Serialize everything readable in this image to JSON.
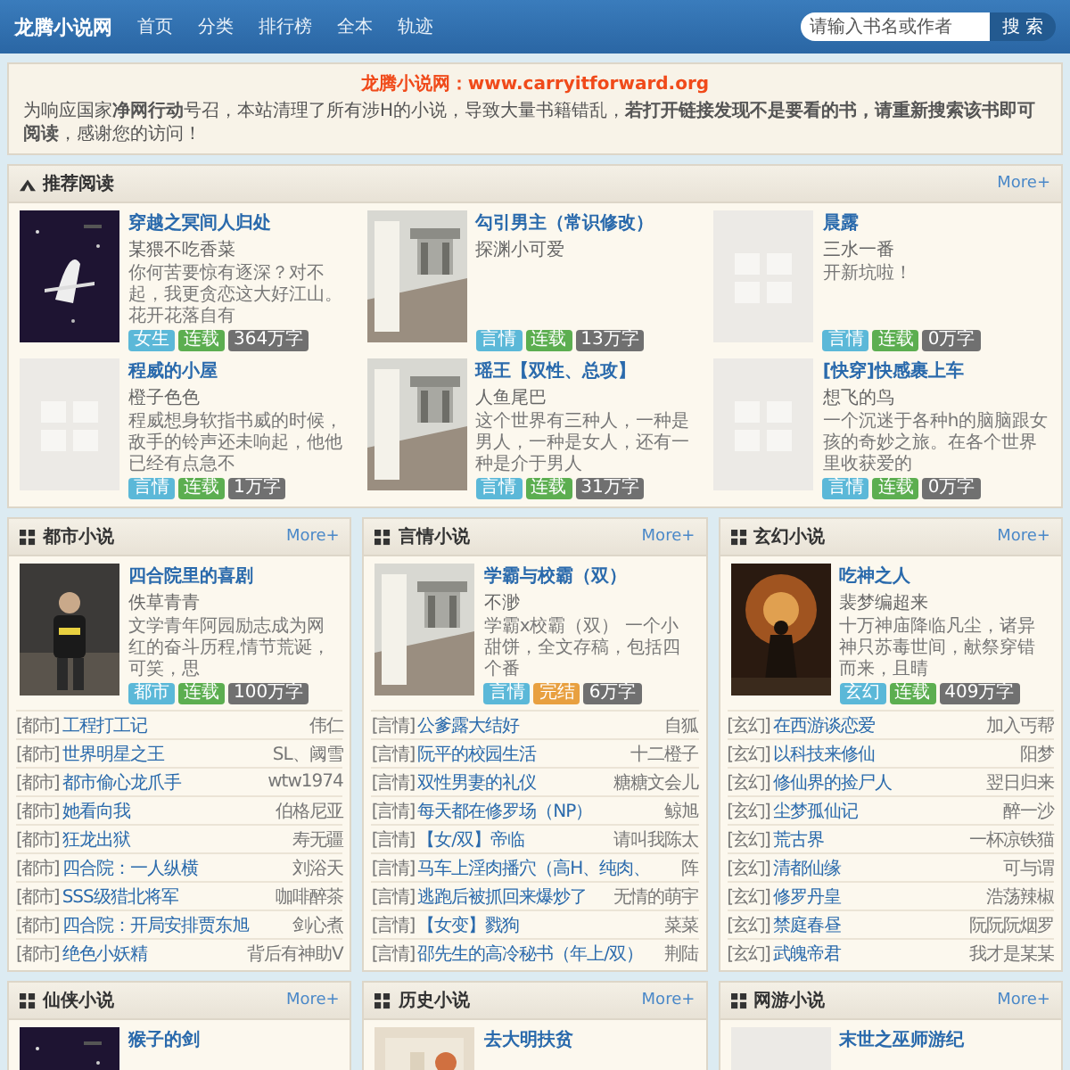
{
  "header": {
    "logo": "龙腾小说网",
    "nav": [
      {
        "label": "首页"
      },
      {
        "label": "分类"
      },
      {
        "label": "排行榜"
      },
      {
        "label": "全本"
      },
      {
        "label": "轨迹"
      }
    ],
    "search": {
      "placeholder": "请输入书名或作者",
      "button": "搜 索"
    }
  },
  "notice": {
    "title": "龙腾小说网：www.carryitforward.org",
    "text": "为响应国家**净网行动**号召，本站清理了所有涉H的小说，导致大量书籍错乱，**若打开链接发现不是要看的书，请重新搜索该书即可阅读**，感谢您的访问！"
  },
  "recommended": {
    "title": "推荐阅读",
    "more": "More+",
    "books": [
      {
        "title": "穿越之冥间人归处",
        "author": "某猥不吃香菜",
        "desc": "你何苦要惊有逐深？对不起，我更贪恋这大好江山。花开花落自有",
        "tags": [
          {
            "kind": "category",
            "text": "女生"
          },
          {
            "kind": "serial",
            "text": "连载"
          },
          {
            "kind": "count",
            "text": "364万字"
          }
        ]
      },
      {
        "title": "勾引男主（常识修改）",
        "author": "探渊小可爱",
        "tags": [
          {
            "kind": "category",
            "text": "言情"
          },
          {
            "kind": "serial",
            "text": "连载"
          },
          {
            "kind": "count",
            "text": "13万字"
          }
        ]
      },
      {
        "title": "晨露",
        "author": "三水一番",
        "desc": "开新坑啦！",
        "tags": [
          {
            "kind": "category",
            "text": "言情"
          },
          {
            "kind": "serial",
            "text": "连载"
          },
          {
            "kind": "count",
            "text": "0万字"
          }
        ]
      },
      {
        "title": "程威的小屋",
        "author": "橙子色色",
        "desc": "程威想身软指书威的时候，敌手的铃声还未响起，他他已经有点急不",
        "tags": [
          {
            "kind": "category",
            "text": "言情"
          },
          {
            "kind": "serial",
            "text": "连载"
          },
          {
            "kind": "count",
            "text": "1万字"
          }
        ]
      },
      {
        "title": "瑶王【双性、总攻】",
        "author": "人鱼尾巴",
        "desc": "这个世界有三种人，一种是男人，一种是女人，还有一种是介于男人",
        "tags": [
          {
            "kind": "category",
            "text": "言情"
          },
          {
            "kind": "serial",
            "text": "连载"
          },
          {
            "kind": "count",
            "text": "31万字"
          }
        ]
      },
      {
        "title": "[快穿]快感裹上车",
        "author": "想飞的鸟",
        "desc": "一个沉迷于各种h的脑脑跟女孩的奇妙之旅。在各个世界里收获爱的",
        "tags": [
          {
            "kind": "category",
            "text": "言情"
          },
          {
            "kind": "serial",
            "text": "连载"
          },
          {
            "kind": "count",
            "text": "0万字"
          }
        ]
      }
    ]
  },
  "categories": [
    {
      "title": "都市小说",
      "more": "More+",
      "featured": {
        "title": "四合院里的喜剧",
        "author": "佚草青青",
        "desc": "文学青年阿园励志成为网红的奋斗历程,情节荒诞，可笑，思",
        "tags": [
          {
            "kind": "category",
            "text": "都市"
          },
          {
            "kind": "serial",
            "text": "连载"
          },
          {
            "kind": "count",
            "text": "100万字"
          }
        ]
      },
      "list": [
        {
          "category": "[都市]",
          "title": "工程打工记",
          "author": "伟仁"
        },
        {
          "category": "[都市]",
          "title": "世界明星之王",
          "author": "SL、阈雪"
        },
        {
          "category": "[都市]",
          "title": "都市偷心龙爪手",
          "author": "wtw1974"
        },
        {
          "category": "[都市]",
          "title": "她看向我",
          "author": "伯格尼亚"
        },
        {
          "category": "[都市]",
          "title": "狂龙出狱",
          "author": "寿无疆"
        },
        {
          "category": "[都市]",
          "title": "四合院：一人纵横",
          "author": "刘浴天"
        },
        {
          "category": "[都市]",
          "title": "SSS级猎北将军",
          "author": "咖啡醉茶"
        },
        {
          "category": "[都市]",
          "title": "四合院：开局安排贾东旭",
          "author": "剑心煮"
        },
        {
          "category": "[都市]",
          "title": "绝色小妖精",
          "author": "背后有神助V"
        }
      ]
    },
    {
      "title": "言情小说",
      "more": "More+",
      "featured": {
        "title": "学霸与校霸（双）",
        "author": "不渺",
        "desc": "学霸x校霸（双） 一个小甜饼，全文存稿，包括四个番",
        "tags": [
          {
            "kind": "category",
            "text": "言情"
          },
          {
            "kind": "finished",
            "text": "完结"
          },
          {
            "kind": "count",
            "text": "6万字"
          }
        ]
      },
      "list": [
        {
          "category": "[言情]",
          "title": "公爹露大结好",
          "author": "自狐"
        },
        {
          "category": "[言情]",
          "title": "阮平的校园生活",
          "author": "十二橙子"
        },
        {
          "category": "[言情]",
          "title": "双性男妻的礼仪",
          "author": "糖糖文会儿"
        },
        {
          "category": "[言情]",
          "title": "每天都在修罗场（NP）",
          "author": "鲸旭"
        },
        {
          "category": "[言情]",
          "title": "【女/双】帝临",
          "author": "请叫我陈太"
        },
        {
          "category": "[言情]",
          "title": "马车上淫肉播穴（高H、纯肉、",
          "author": "阵"
        },
        {
          "category": "[言情]",
          "title": "逃跑后被抓回来爆炒了",
          "author": "无情的萌宇"
        },
        {
          "category": "[言情]",
          "title": "【女变】戮狗",
          "author": "菜菜"
        },
        {
          "category": "[言情]",
          "title": "邵先生的高冷秘书（年上/双）",
          "author": "荆陆"
        }
      ]
    },
    {
      "title": "玄幻小说",
      "more": "More+",
      "featured": {
        "title": "吃神之人",
        "author": "裴梦编超来",
        "desc": "十万神庙降临凡尘，诸异神只苏毒世间，献祭穿错而来，且晴",
        "tags": [
          {
            "kind": "category",
            "text": "玄幻"
          },
          {
            "kind": "serial",
            "text": "连载"
          },
          {
            "kind": "count",
            "text": "409万字"
          }
        ]
      },
      "list": [
        {
          "category": "[玄幻]",
          "title": "在西游谈恋爱",
          "author": "加入丐帮"
        },
        {
          "category": "[玄幻]",
          "title": "以科技来修仙",
          "author": "阳梦"
        },
        {
          "category": "[玄幻]",
          "title": "修仙界的捡尸人",
          "author": "翌日归来"
        },
        {
          "category": "[玄幻]",
          "title": "尘梦孤仙记",
          "author": "醉一沙"
        },
        {
          "category": "[玄幻]",
          "title": "荒古界",
          "author": "一杯凉铁猫"
        },
        {
          "category": "[玄幻]",
          "title": "清都仙缘",
          "author": "可与谓"
        },
        {
          "category": "[玄幻]",
          "title": "修罗丹皇",
          "author": "浩荡辣椒"
        },
        {
          "category": "[玄幻]",
          "title": "禁庭春昼",
          "author": "阮阮阮烟罗"
        },
        {
          "category": "[玄幻]",
          "title": "武魄帝君",
          "author": "我才是某某"
        }
      ]
    },
    {
      "title": "仙侠小说",
      "more": "More+",
      "featured": {
        "title": "猴子的剑"
      }
    },
    {
      "title": "历史小说",
      "more": "More+",
      "featured": {
        "title": "去大明扶贫"
      }
    },
    {
      "title": "网游小说",
      "more": "More+",
      "featured": {
        "title": "末世之巫师游纪"
      }
    }
  ]
}
